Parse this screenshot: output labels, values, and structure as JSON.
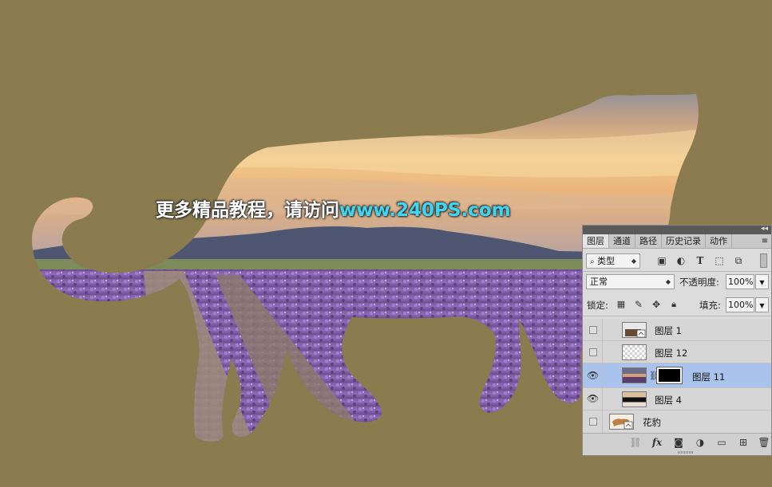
{
  "watermark": {
    "prefix": "更多精品教程，请访问",
    "url": "www.240PS.com"
  },
  "layers_panel": {
    "tabs": [
      "图层",
      "通道",
      "路径",
      "历史记录",
      "动作"
    ],
    "active_tab": "图层",
    "filter": {
      "kind_label": "类型"
    },
    "blend_mode": "正常",
    "opacity_label": "不透明度:",
    "opacity_value": "100%",
    "lock_label": "锁定:",
    "fill_label": "填充:",
    "fill_value": "100%",
    "layers": [
      {
        "name": "图层 1",
        "visible": false,
        "selected": false,
        "thumb": "smart-object",
        "has_mask": false
      },
      {
        "name": "图层 12",
        "visible": false,
        "selected": false,
        "thumb": "transparent",
        "has_mask": false
      },
      {
        "name": "图层 11",
        "visible": true,
        "selected": true,
        "thumb": "sunset",
        "has_mask": true
      },
      {
        "name": "图层 4",
        "visible": true,
        "selected": false,
        "thumb": "landscape",
        "has_mask": false
      },
      {
        "name": "花豹",
        "visible": false,
        "selected": false,
        "thumb": "leopard-smart-object",
        "has_mask": false
      }
    ],
    "bottom_icons": [
      "link-icon",
      "fx-icon",
      "mask-icon",
      "adjustment-icon",
      "group-folder-icon",
      "new-layer-icon",
      "trash-icon"
    ]
  },
  "colors": {
    "canvas_bg": "#8b7c4f",
    "selected_row": "#a9c3ec",
    "url_color": "#3fd6f2"
  }
}
